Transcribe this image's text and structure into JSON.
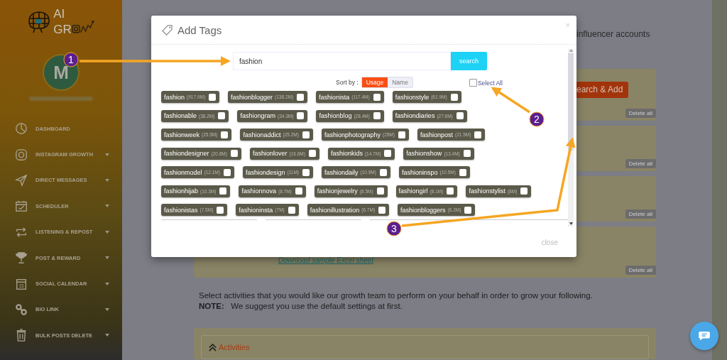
{
  "sidebar": {
    "logo": {
      "line_1": "AI",
      "line_2": "GR"
    },
    "avatar": {
      "initial": "M"
    },
    "items": [
      {
        "label": "DASHBOARD",
        "caret": false
      },
      {
        "label": "INSTAGRAM GROWTH",
        "caret": true
      },
      {
        "label": "DIRECT MESSAGES",
        "caret": true
      },
      {
        "label": "SCHEDULER",
        "caret": true
      },
      {
        "label": "LISTENING & REPOST",
        "caret": true
      },
      {
        "label": "POST & REWARD",
        "caret": true
      },
      {
        "label": "SOCIAL CALENDAR",
        "caret": true,
        "day": "15"
      },
      {
        "label": "BIO LINK",
        "caret": true
      },
      {
        "label": "BULK POSTS DELETE",
        "caret": true
      }
    ]
  },
  "main": {
    "intro_fragment": "influencer accounts",
    "panels": [
      {
        "button": "earch & Add",
        "delete": "Delete all"
      },
      {
        "delete": "Delete all"
      },
      {
        "delete": "Delete all"
      },
      {
        "link": "Download sample Excel sheet",
        "delete": "Delete all"
      }
    ],
    "instructions": "Select activities that you would like our growth team to perform on your behalf in order to grow your following.",
    "note": "**NOTE:**   We suggest you use the default settings at first.",
    "activities": {
      "label": "Activities",
      "expanded": true
    }
  },
  "modal": {
    "title": "Add Tags",
    "close_x": "×",
    "search": {
      "value": "fashion",
      "button": "search"
    },
    "sort": {
      "label": "Sort by :",
      "options": [
        {
          "label": "Usage",
          "selected": true
        },
        {
          "label": "Name",
          "selected": false
        }
      ]
    },
    "select_all": {
      "label": "Select All",
      "checked": false
    },
    "tag_rows": [
      [
        {
          "name": "fashion",
          "count": "(917.9M)",
          "checked": false
        },
        {
          "name": "fashionblogger",
          "count": "(138.2M)",
          "checked": false
        },
        {
          "name": "fashionista",
          "count": "(117.4M)",
          "checked": false
        },
        {
          "name": "fashionstyle",
          "count": "(61.9M)",
          "checked": false
        }
      ],
      [
        {
          "name": "fashionable",
          "count": "(38.2M)",
          "checked": false
        },
        {
          "name": "fashiongram",
          "count": "(34.3M)",
          "checked": false
        },
        {
          "name": "fashionblog",
          "count": "(28.4M)",
          "checked": false
        },
        {
          "name": "fashiondiaries",
          "count": "(27.6M)",
          "checked": false
        }
      ],
      [
        {
          "name": "fashionweek",
          "count": "(25.5M)",
          "checked": false
        },
        {
          "name": "fashionaddict",
          "count": "(25.2M)",
          "checked": false
        },
        {
          "name": "fashionphotography",
          "count": "(25M)",
          "checked": false
        },
        {
          "name": "fashionpost",
          "count": "(21.5M)",
          "checked": false
        }
      ],
      [
        {
          "name": "fashiondesigner",
          "count": "(20.8M)",
          "checked": false
        },
        {
          "name": "fashionlover",
          "count": "(16.6M)",
          "checked": false
        },
        {
          "name": "fashionkids",
          "count": "(14.7M)",
          "checked": false
        },
        {
          "name": "fashionshow",
          "count": "(13.4M)",
          "checked": false
        }
      ],
      [
        {
          "name": "fashionmodel",
          "count": "(12.1M)",
          "checked": false
        },
        {
          "name": "fashiondesign",
          "count": "(11M)",
          "checked": false
        },
        {
          "name": "fashiondaily",
          "count": "(10.9M)",
          "checked": false
        },
        {
          "name": "fashioninspo",
          "count": "(10.5M)",
          "checked": false
        }
      ],
      [
        {
          "name": "fashionhijab",
          "count": "(10.3M)",
          "checked": false
        },
        {
          "name": "fashionnova",
          "count": "(8.7M)",
          "checked": false
        },
        {
          "name": "fashionjewelry",
          "count": "(8.5M)",
          "checked": false
        },
        {
          "name": "fashiongirl",
          "count": "(8.1M)",
          "checked": false
        },
        {
          "name": "fashionstylist",
          "count": "(8M)",
          "checked": false
        }
      ],
      [
        {
          "name": "fashionistas",
          "count": "(7.5M)",
          "checked": false
        },
        {
          "name": "fashioninsta",
          "count": "(7M)",
          "checked": false
        },
        {
          "name": "fashionillustration",
          "count": "(6.7M)",
          "checked": false
        },
        {
          "name": "fashionbloggers",
          "count": "(6.2M)",
          "checked": false
        }
      ]
    ],
    "footer_button": "close"
  },
  "annotations": [
    {
      "label": "1"
    },
    {
      "label": "2"
    },
    {
      "label": "3"
    }
  ]
}
